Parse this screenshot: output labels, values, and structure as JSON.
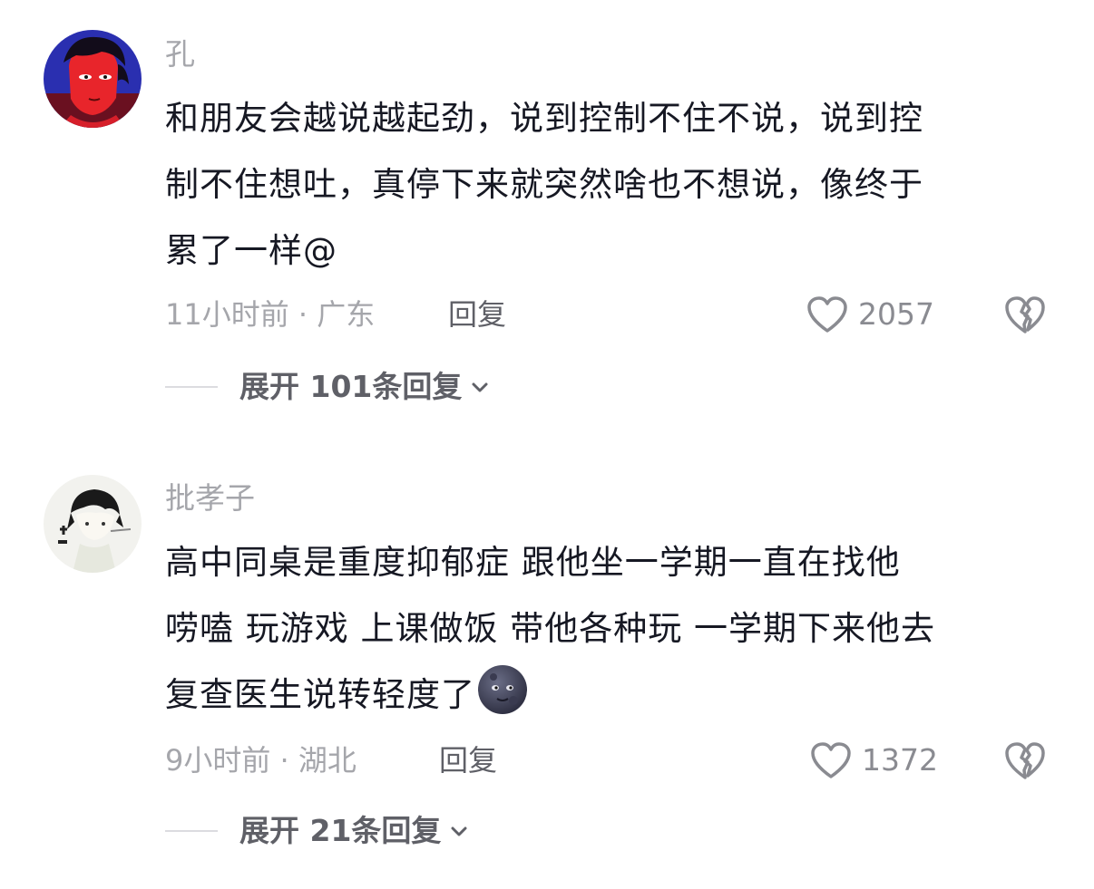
{
  "comments": [
    {
      "username": "孔",
      "avatar": "avatar-red-character",
      "lines": [
        "和朋友会越说越起劲，说到控制不住不说，说到控",
        "制不住想吐，真停下来就突然啥也不想说，像终于",
        "累了一样@"
      ],
      "time_location": "11小时前 · 广东",
      "reply_label": "回复",
      "likes": "2057",
      "expand_label": "展开 101条回复"
    },
    {
      "username": "批孝子",
      "avatar": "avatar-sketch-character",
      "lines": [
        "高中同桌是重度抑郁症 跟他坐一学期一直在找他",
        "唠嗑 玩游戏 上课做饭 带他各种玩 一学期下来他去",
        "复查医生说转轻度了"
      ],
      "emoji": "new-moon-face-icon",
      "time_location": "9小时前 · 湖北",
      "reply_label": "回复",
      "likes": "1372",
      "expand_label": "展开 21条回复"
    }
  ],
  "colors": {
    "text_primary": "#161823",
    "text_secondary": "#a5a6ab",
    "text_action": "#5f6067",
    "divider": "#dcdce0"
  }
}
